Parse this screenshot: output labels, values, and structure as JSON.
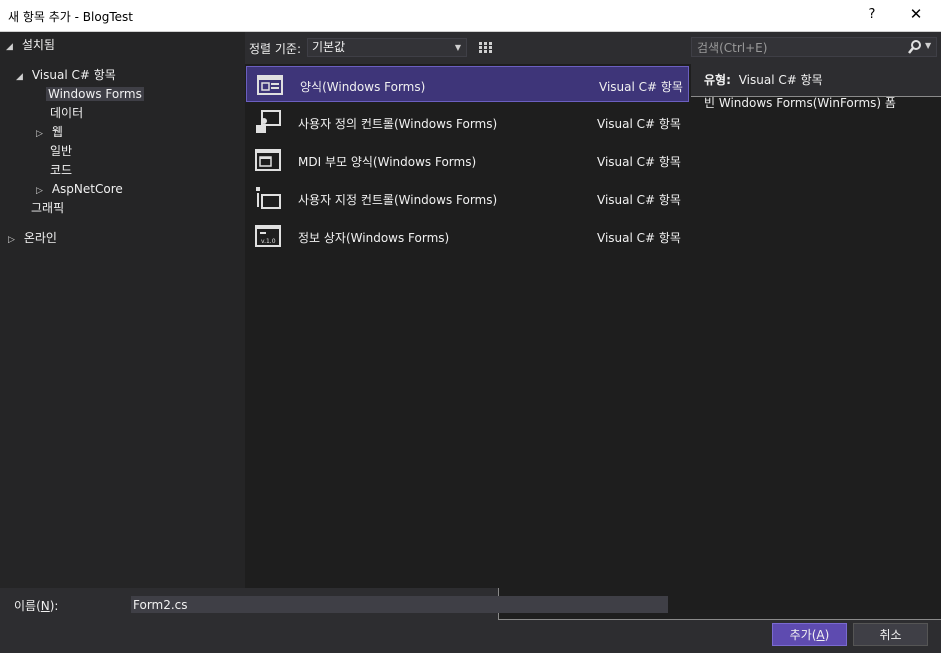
{
  "window": {
    "title": "새 항목 추가 - BlogTest",
    "help": "?",
    "close": "✕"
  },
  "tree": {
    "installed": "설치됨",
    "visual_csharp": "Visual C# 항목",
    "windows_forms": "Windows Forms",
    "data": "데이터",
    "web": "웹",
    "general": "일반",
    "code": "코드",
    "aspnetcore": "AspNetCore",
    "graphics": "그래픽",
    "online": "온라인"
  },
  "sort": {
    "label": "정렬 기준:",
    "value": "기본값"
  },
  "items": [
    {
      "name": "양식(Windows Forms)",
      "category": "Visual C# 항목",
      "icon": "form-icon"
    },
    {
      "name": "사용자 정의 컨트롤(Windows Forms)",
      "category": "Visual C# 항목",
      "icon": "user-control-icon"
    },
    {
      "name": "MDI 부모 양식(Windows Forms)",
      "category": "Visual C# 항목",
      "icon": "mdi-form-icon"
    },
    {
      "name": "사용자 지정 컨트롤(Windows Forms)",
      "category": "Visual C# 항목",
      "icon": "custom-control-icon"
    },
    {
      "name": "정보 상자(Windows Forms)",
      "category": "Visual C# 항목",
      "icon": "about-box-icon"
    }
  ],
  "search": {
    "placeholder": "검색(Ctrl+E)"
  },
  "detail": {
    "type_label": "유형:",
    "type_value": "Visual C# 항목",
    "description": "빈 Windows Forms(WinForms) 폼"
  },
  "name_field": {
    "label_pre": "이름(",
    "label_key": "N",
    "label_post": "):",
    "value": "Form2.cs"
  },
  "buttons": {
    "add_pre": "추가(",
    "add_key": "A",
    "add_post": ")",
    "cancel": "취소"
  },
  "colors": {
    "accent": "#5e4bb0",
    "selection": "#3e3579",
    "background": "#2d2d30"
  }
}
